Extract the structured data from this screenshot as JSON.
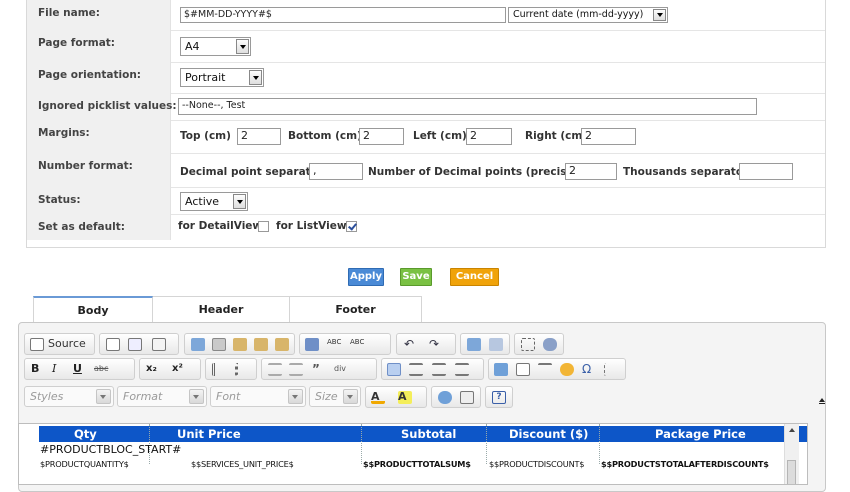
{
  "form": {
    "rows": [
      {
        "label": "File name:"
      },
      {
        "label": "Page format:"
      },
      {
        "label": "Page orientation:"
      },
      {
        "label": "Ignored picklist values:"
      },
      {
        "label": "Margins:"
      },
      {
        "label": "Number format:"
      },
      {
        "label": "Status:"
      },
      {
        "label": "Set as default:"
      }
    ],
    "file_name_value": "$#MM-DD-YYYY#$",
    "date_select": "Current date (mm-dd-yyyy)",
    "page_format": "A4",
    "page_orientation": "Portrait",
    "ignored_picklist": "--None--, Test",
    "margins": {
      "top_label": "Top (cm)",
      "top_value": "2",
      "bottom_label": "Bottom (cm)",
      "bottom_value": "2",
      "left_label": "Left (cm)",
      "left_value": "2",
      "right_label": "Right (cm)",
      "right_value": "2"
    },
    "number_format": {
      "decimal_sep_label": "Decimal point separator",
      "decimal_sep_value": ",",
      "precision_label": "Number of Decimal points (precision)",
      "precision_value": "2",
      "thousands_label": "Thousands separator",
      "thousands_value": ""
    },
    "status": "Active",
    "default": {
      "detail_label": "for DetailView",
      "detail_checked": false,
      "list_label": "for ListView",
      "list_checked": true
    }
  },
  "actions": {
    "apply": "Apply",
    "save": "Save",
    "cancel": "Cancel"
  },
  "tabs": [
    "Body",
    "Header",
    "Footer"
  ],
  "toolbar": {
    "source_label": "Source",
    "styles_placeholder": "Styles",
    "format_placeholder": "Format",
    "font_placeholder": "Font",
    "size_placeholder": "Size"
  },
  "table": {
    "headers": [
      "Qty",
      "Unit Price",
      "Subtotal",
      "Discount ($)",
      "Package Price"
    ],
    "block_start": "#PRODUCTBLOC_START#",
    "cells": [
      "$PRODUCTQUANTITY$",
      "$$SERVICES_UNIT_PRICE$",
      "$$PRODUCTTOTALSUM$",
      "$$PRODUCTDISCOUNT$",
      "$$PRODUCTSTOTALAFTERDISCOUNT$"
    ]
  }
}
